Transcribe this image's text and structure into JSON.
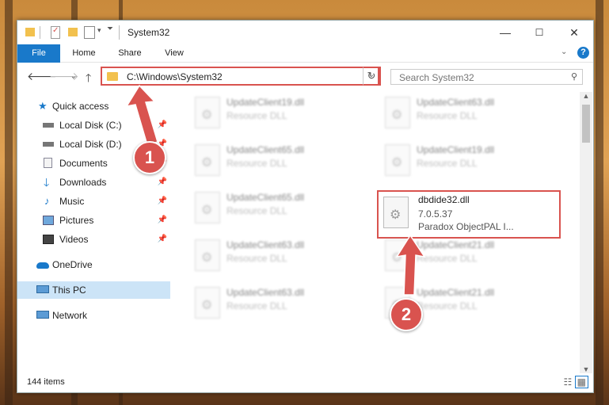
{
  "window": {
    "title": "System32",
    "controls": [
      "—",
      "☐",
      "✕"
    ]
  },
  "ribbon": {
    "tabs": [
      "File",
      "Home",
      "Share",
      "View"
    ],
    "help_label": "?"
  },
  "address": {
    "path": "C:\\Windows\\System32",
    "search_placeholder": "Search System32"
  },
  "nav": {
    "items": [
      {
        "label": "Quick access",
        "icon": "star-icon"
      },
      {
        "label": "Local Disk (C:)",
        "icon": "drive-icon",
        "pinned": true
      },
      {
        "label": "Local Disk (D:)",
        "icon": "drive-icon",
        "pinned": true
      },
      {
        "label": "Documents",
        "icon": "documents-icon",
        "pinned": true
      },
      {
        "label": "Downloads",
        "icon": "downloads-icon",
        "pinned": true
      },
      {
        "label": "Music",
        "icon": "music-icon",
        "pinned": true
      },
      {
        "label": "Pictures",
        "icon": "pictures-icon",
        "pinned": true
      },
      {
        "label": "Videos",
        "icon": "videos-icon",
        "pinned": true
      },
      {
        "label": "OneDrive",
        "icon": "cloud-icon"
      },
      {
        "label": "This PC",
        "icon": "computer-icon",
        "selected": true
      },
      {
        "label": "Network",
        "icon": "network-icon"
      }
    ]
  },
  "files": {
    "left": [
      {
        "name": "UpdateClient19.dll",
        "type": "Resource DLL"
      },
      {
        "name": "UpdateClient65.dll",
        "type": "Resource DLL"
      },
      {
        "name": "UpdateClient65.dll",
        "type": "Resource DLL"
      },
      {
        "name": "UpdateClient63.dll",
        "type": "Resource DLL"
      },
      {
        "name": "UpdateClient63.dll",
        "type": "Resource DLL"
      }
    ],
    "right": [
      {
        "name": "UpdateClient63.dll",
        "type": "Resource DLL"
      },
      {
        "name": "UpdateClient19.dll",
        "type": "Resource DLL"
      },
      {
        "name": "UpdateClient21.dll",
        "type": "Resource DLL"
      },
      {
        "name": "UpdateClient21.dll",
        "type": "Resource DLL"
      }
    ],
    "selected": {
      "name": "dbdide32.dll",
      "version": "7.0.5.37",
      "description": "Paradox ObjectPAL I..."
    }
  },
  "status": {
    "item_count": "144 items"
  },
  "callouts": [
    "1",
    "2"
  ],
  "colors": {
    "accent": "#1979ca",
    "highlight": "#d9534f"
  }
}
